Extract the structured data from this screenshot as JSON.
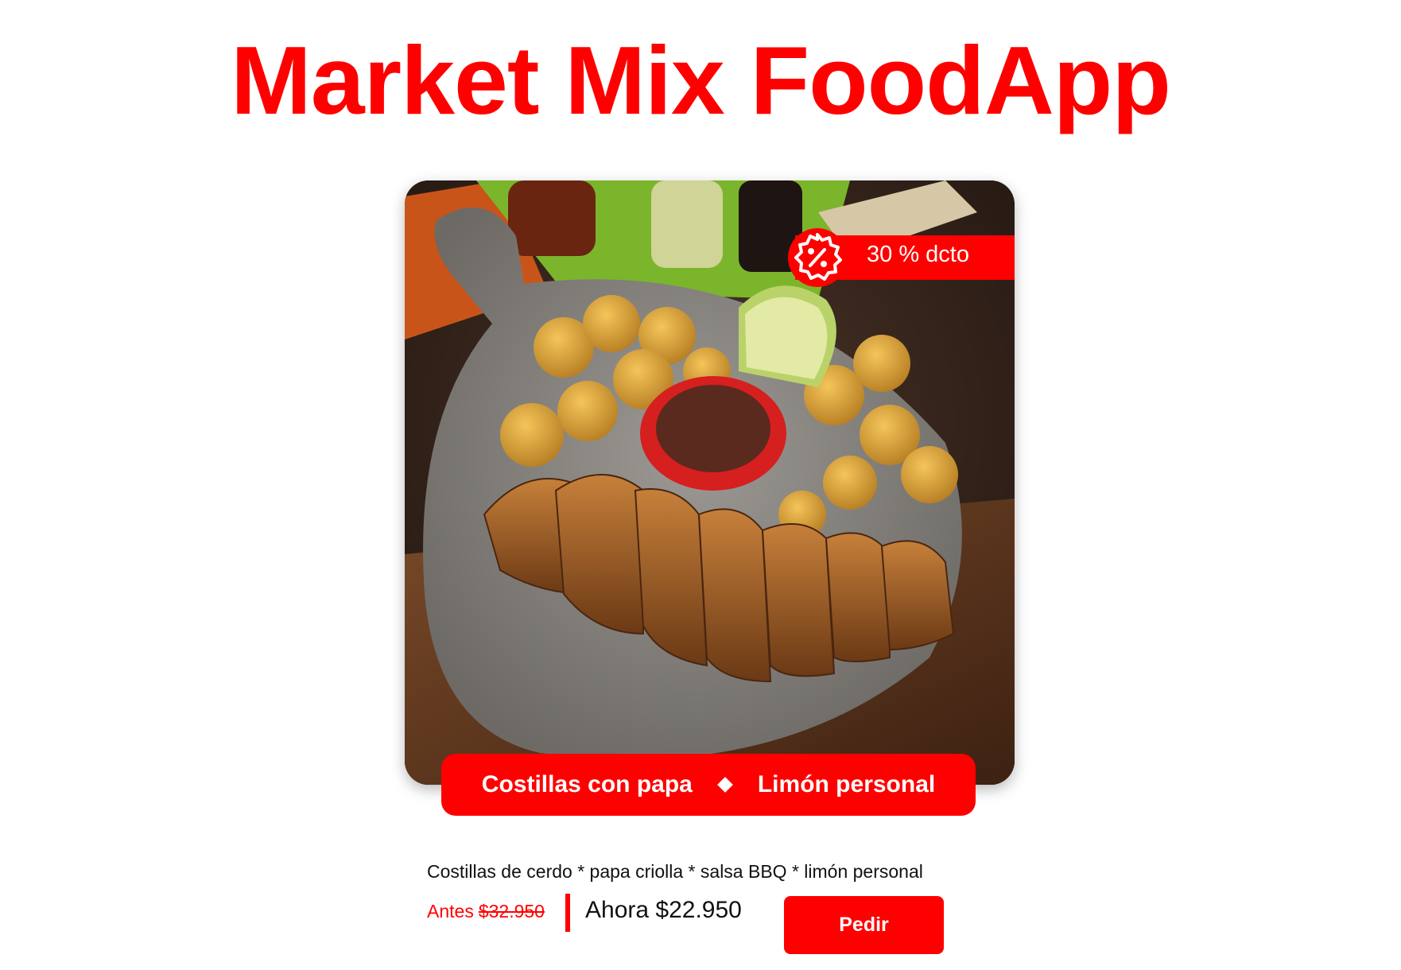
{
  "header": {
    "title": "Market Mix FoodApp"
  },
  "product": {
    "image_icon": "food-photo-ribs-potatoes",
    "discount": {
      "icon": "percent-badge-icon",
      "label": "30 % dcto"
    },
    "name_main": "Costillas con papa",
    "name_extra": "Limón personal",
    "description": "Costillas de cerdo * papa criolla * salsa BBQ * limón personal",
    "price_before_label": "Antes",
    "price_before_value": "$32.950",
    "price_now": "Ahora $22.950",
    "order_label": "Pedir"
  },
  "colors": {
    "accent": "#ff0000",
    "text": "#111111",
    "background": "#ffffff"
  }
}
